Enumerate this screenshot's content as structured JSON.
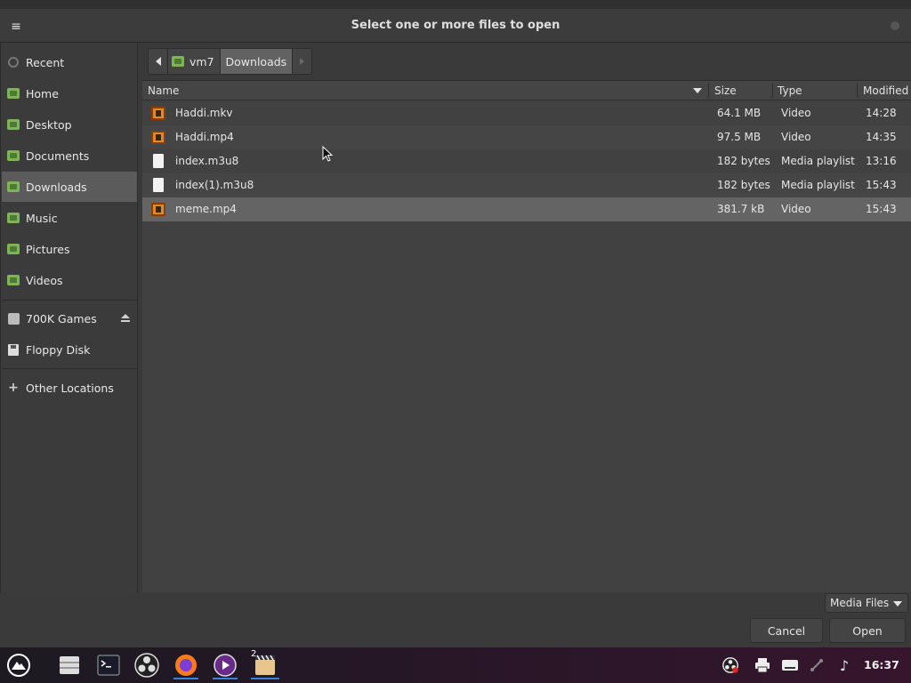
{
  "window": {
    "title": "Select one or more files to open"
  },
  "sidebar": {
    "items": [
      {
        "label": "Recent"
      },
      {
        "label": "Home"
      },
      {
        "label": "Desktop"
      },
      {
        "label": "Documents"
      },
      {
        "label": "Downloads",
        "active": true
      },
      {
        "label": "Music"
      },
      {
        "label": "Pictures"
      },
      {
        "label": "Videos"
      },
      {
        "label": "700K Games"
      },
      {
        "label": "Floppy Disk"
      },
      {
        "label": "Other Locations"
      }
    ]
  },
  "pathbar": {
    "crumbs": [
      "vm7",
      "Downloads"
    ]
  },
  "filelist": {
    "columns": [
      "Name",
      "Size",
      "Type",
      "Modified"
    ],
    "rows": [
      {
        "name": "Haddi.mkv",
        "size": "64.1 MB",
        "type": "Video",
        "modified": "14:28",
        "icon": "video-file-icon"
      },
      {
        "name": "Haddi.mp4",
        "size": "97.5 MB",
        "type": "Video",
        "modified": "14:35",
        "icon": "video-file-icon"
      },
      {
        "name": "index.m3u8",
        "size": "182 bytes",
        "type": "Media playlist",
        "modified": "13:16",
        "icon": "document-file-icon"
      },
      {
        "name": "index(1).m3u8",
        "size": "182 bytes",
        "type": "Media playlist",
        "modified": "15:43",
        "icon": "document-file-icon"
      },
      {
        "name": "meme.mp4",
        "size": "381.7 kB",
        "type": "Video",
        "modified": "15:43",
        "icon": "video-file-icon",
        "selected": true
      }
    ]
  },
  "footer": {
    "filter": "Media Files",
    "cancel": "Cancel",
    "open": "Open"
  },
  "taskbar": {
    "workspace_badge": "2",
    "clock": "16:37"
  },
  "colors": {
    "folder_green": "#7fb357",
    "video_orange": "#e08a24",
    "selection": "#646464",
    "taskbar_accent": "#3d7fd6"
  }
}
